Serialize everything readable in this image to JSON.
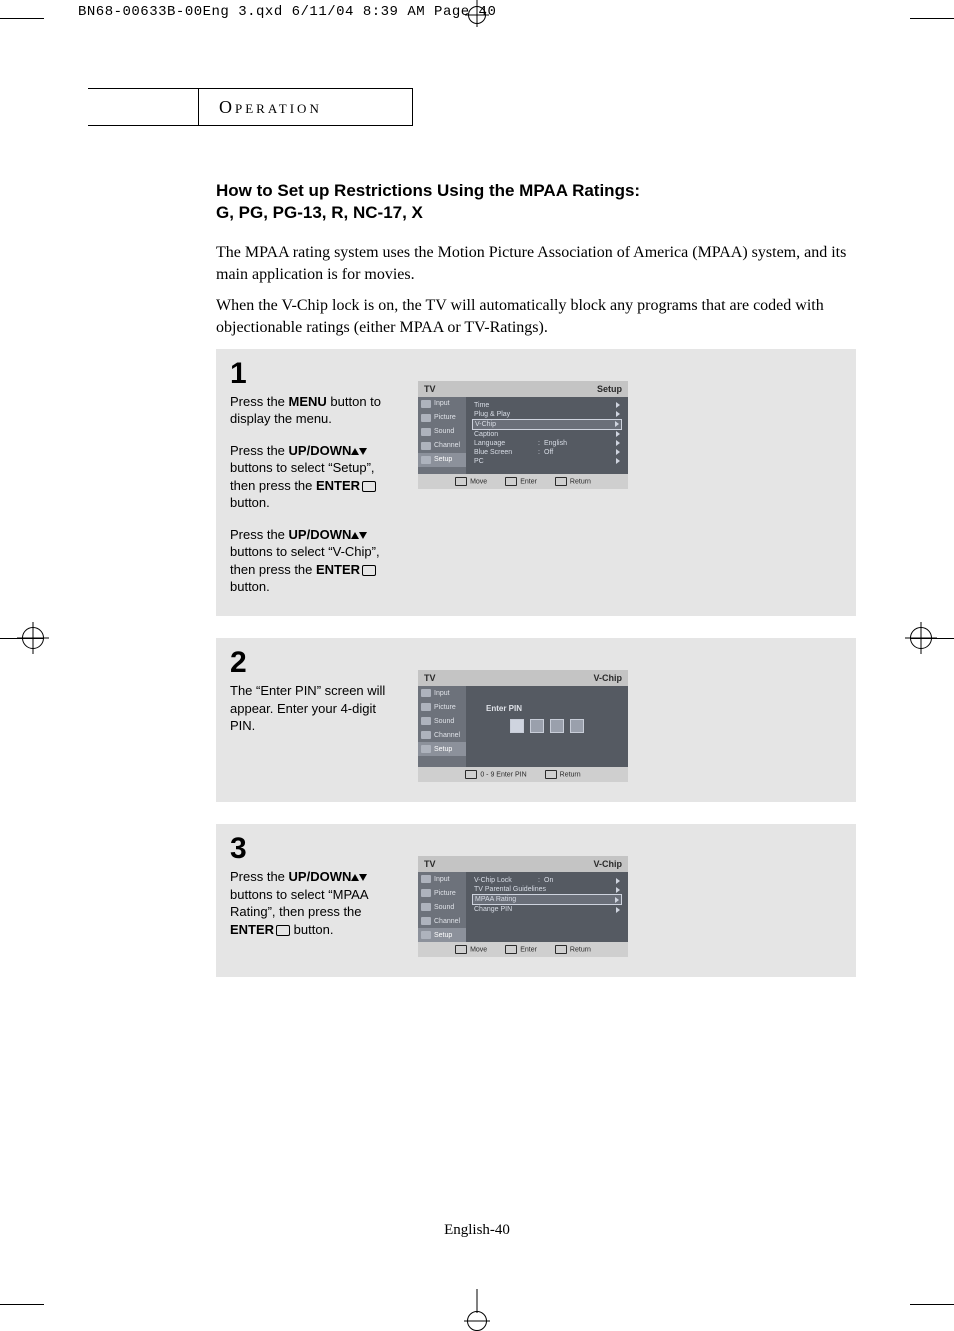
{
  "slug": "BN68-00633B-00Eng 3.qxd  6/11/04 8:39 AM  Page 40",
  "section_label": "Operation",
  "title_line1": "How to Set up Restrictions Using the MPAA Ratings:",
  "title_line2": "G, PG, PG-13, R, NC-17, X",
  "intro1": "The MPAA rating system uses the Motion Picture Association of America (MPAA) system, and its main application is for movies.",
  "intro2": "When the V-Chip lock is on, the TV will automatically block any programs that are coded with objectionable ratings (either MPAA or TV-Ratings).",
  "steps": [
    {
      "num": "1",
      "paras": [
        [
          {
            "t": "Press the "
          },
          {
            "t": "MENU",
            "b": true
          },
          {
            "t": " button to display the menu."
          }
        ],
        [
          {
            "t": "Press the "
          },
          {
            "t": "UP/DOWN",
            "b": true
          },
          {
            "arrows": true
          },
          {
            "t": " buttons to select “Setup”, then press the "
          },
          {
            "t": "ENTER",
            "b": true
          },
          {
            "icon": "enter"
          },
          {
            "t": " button."
          }
        ],
        [
          {
            "t": "Press the "
          },
          {
            "t": "UP/DOWN",
            "b": true
          },
          {
            "arrows": true
          },
          {
            "t": " buttons to select “V-Chip”, then press the "
          },
          {
            "t": "ENTER",
            "b": true
          },
          {
            "icon": "enter"
          },
          {
            "t": " button."
          }
        ]
      ],
      "osd": {
        "title_left": "TV",
        "title_right": "Setup",
        "tabs": [
          "Input",
          "Picture",
          "Sound",
          "Channel",
          "Setup"
        ],
        "active_tab": 4,
        "rows": [
          {
            "k": "Time"
          },
          {
            "k": "Plug & Play"
          },
          {
            "k": "V-Chip",
            "hl": true
          },
          {
            "k": "Caption"
          },
          {
            "k": "Language",
            "v": "English"
          },
          {
            "k": "Blue Screen",
            "v": "Off"
          },
          {
            "k": "PC"
          }
        ],
        "foot": [
          "Move",
          "Enter",
          "Return"
        ]
      }
    },
    {
      "num": "2",
      "paras": [
        [
          {
            "t": "The “Enter PIN” screen will appear. Enter your 4-digit PIN."
          }
        ]
      ],
      "osd": {
        "title_left": "TV",
        "title_right": "V-Chip",
        "tabs": [
          "Input",
          "Picture",
          "Sound",
          "Channel",
          "Setup"
        ],
        "active_tab": 4,
        "pin": {
          "label": "Enter PIN",
          "count": 4
        },
        "foot": [
          "0 - 9 Enter PIN",
          "Return"
        ]
      }
    },
    {
      "num": "3",
      "paras": [
        [
          {
            "t": "Press the "
          },
          {
            "t": "UP/DOWN",
            "b": true
          },
          {
            "arrows": true
          },
          {
            "t": " buttons to select  “MPAA Rating”, then press the "
          },
          {
            "t": "ENTER",
            "b": true
          },
          {
            "icon": "enter"
          },
          {
            "t": "  button."
          }
        ]
      ],
      "osd": {
        "title_left": "TV",
        "title_right": "V-Chip",
        "tabs": [
          "Input",
          "Picture",
          "Sound",
          "Channel",
          "Setup"
        ],
        "active_tab": 4,
        "rows": [
          {
            "k": "V-Chip Lock",
            "v": "On"
          },
          {
            "k": "TV Parental Guidelines"
          },
          {
            "k": "MPAA Rating",
            "hl": true
          },
          {
            "k": "Change PIN"
          }
        ],
        "foot": [
          "Move",
          "Enter",
          "Return"
        ]
      }
    }
  ],
  "page_number": "English-40"
}
